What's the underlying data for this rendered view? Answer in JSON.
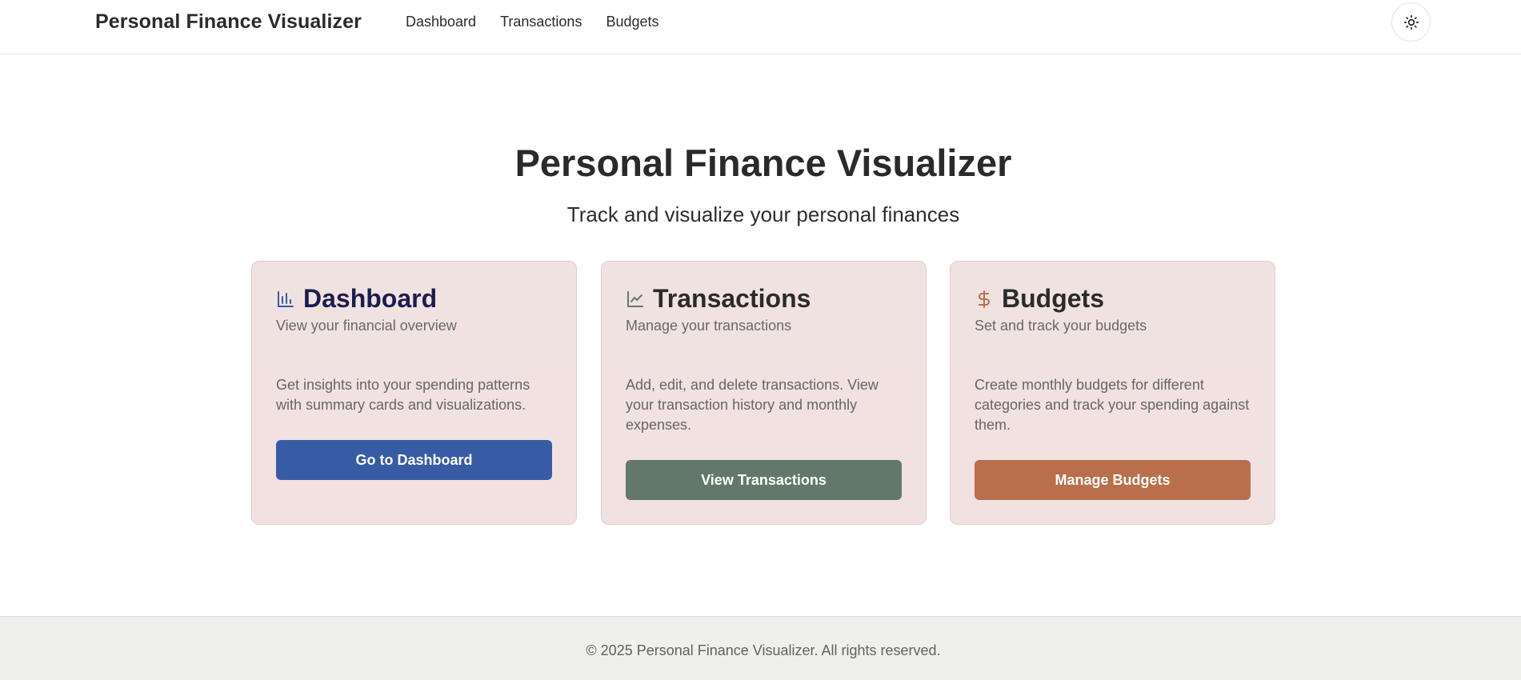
{
  "header": {
    "brand": "Personal Finance Visualizer",
    "nav": [
      {
        "label": "Dashboard"
      },
      {
        "label": "Transactions"
      },
      {
        "label": "Budgets"
      }
    ],
    "theme_toggle_icon": "sun-icon"
  },
  "hero": {
    "title": "Personal Finance Visualizer",
    "subtitle": "Track and visualize your personal finances"
  },
  "cards": [
    {
      "icon": "bar-chart-icon",
      "title": "Dashboard",
      "description": "View your financial overview",
      "body": "Get insights into your spending patterns with summary cards and visualizations.",
      "button_label": "Go to Dashboard",
      "accent": "#385ba5",
      "title_color": "#1c1d4e"
    },
    {
      "icon": "line-chart-icon",
      "title": "Transactions",
      "description": "Manage your transactions",
      "body": "Add, edit, and delete transactions. View your transaction history and monthly expenses.",
      "button_label": "View Transactions",
      "accent": "#62786a",
      "title_color": "#2b2b2b"
    },
    {
      "icon": "dollar-icon",
      "title": "Budgets",
      "description": "Set and track your budgets",
      "body": "Create monthly budgets for different categories and track your spending against them.",
      "button_label": "Manage Budgets",
      "accent": "#b96f4c",
      "title_color": "#2b2b2b"
    }
  ],
  "footer": {
    "text": "© 2025 Personal Finance Visualizer. All rights reserved."
  }
}
